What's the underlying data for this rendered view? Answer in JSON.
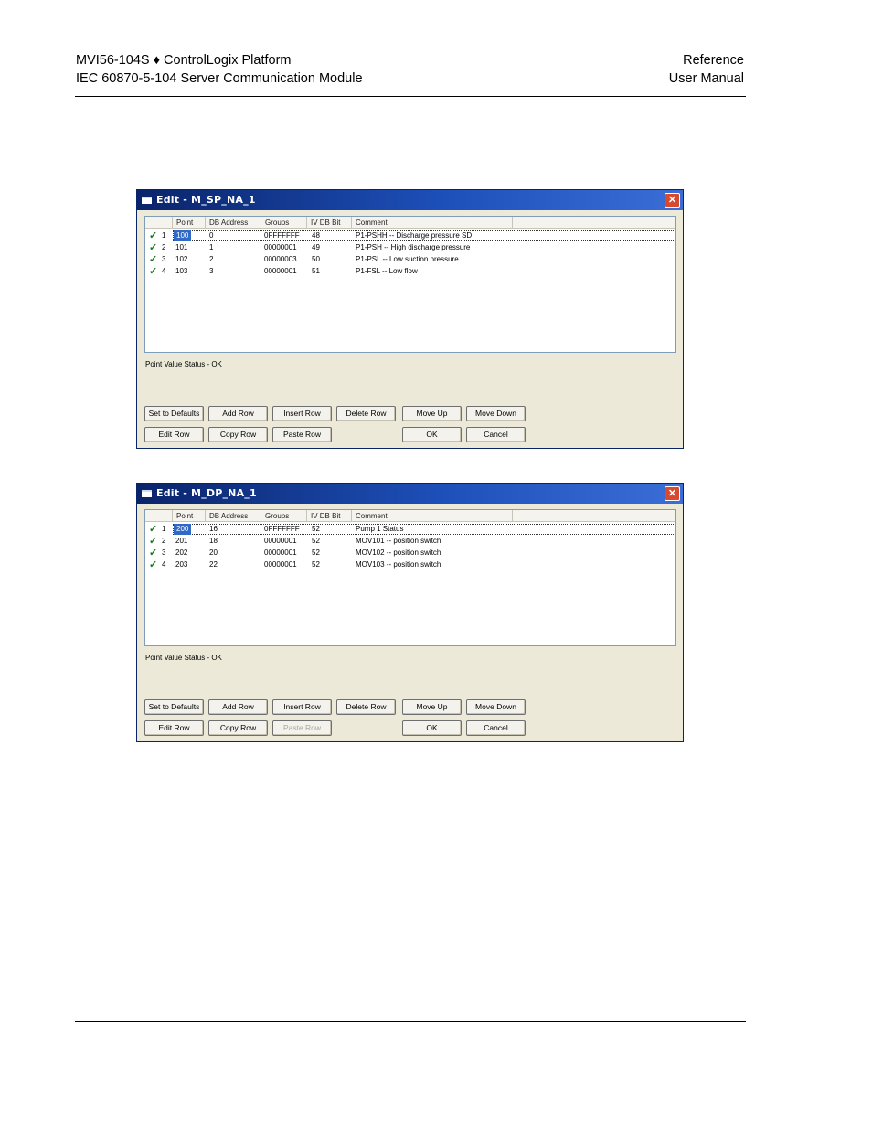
{
  "header": {
    "left_line1": "MVI56-104S ♦ ControlLogix Platform",
    "left_line2": "IEC 60870-5-104 Server Communication Module",
    "right_line1": "Reference",
    "right_line2": "User Manual"
  },
  "dialogs": [
    {
      "title": "Edit - M_SP_NA_1",
      "columns": [
        "Point",
        "DB Address",
        "Groups",
        "IV DB Bit",
        "Comment"
      ],
      "rows": [
        {
          "num": "1",
          "point": "100",
          "db": "0",
          "groups": "0FFFFFFF",
          "iv": "48",
          "comment": "P1-PSHH  -- Discharge pressure SD"
        },
        {
          "num": "2",
          "point": "101",
          "db": "1",
          "groups": "00000001",
          "iv": "49",
          "comment": "P1-PSH  -- High discharge pressure"
        },
        {
          "num": "3",
          "point": "102",
          "db": "2",
          "groups": "00000003",
          "iv": "50",
          "comment": "P1-PSL  -- Low suction pressure"
        },
        {
          "num": "4",
          "point": "103",
          "db": "3",
          "groups": "00000001",
          "iv": "51",
          "comment": "P1-FSL  -- Low flow"
        }
      ],
      "status": "Point Value Status - OK",
      "buttons": {
        "set_defaults": "Set to Defaults",
        "add_row": "Add Row",
        "insert_row": "Insert Row",
        "delete_row": "Delete Row",
        "move_up": "Move Up",
        "move_down": "Move Down",
        "edit_row": "Edit Row",
        "copy_row": "Copy Row",
        "paste_row": "Paste Row",
        "ok": "OK",
        "cancel": "Cancel"
      },
      "paste_enabled": true
    },
    {
      "title": "Edit - M_DP_NA_1",
      "columns": [
        "Point",
        "DB Address",
        "Groups",
        "IV DB Bit",
        "Comment"
      ],
      "rows": [
        {
          "num": "1",
          "point": "200",
          "db": "16",
          "groups": "0FFFFFFF",
          "iv": "52",
          "comment": "Pump 1 Status"
        },
        {
          "num": "2",
          "point": "201",
          "db": "18",
          "groups": "00000001",
          "iv": "52",
          "comment": "MOV101 -- position switch"
        },
        {
          "num": "3",
          "point": "202",
          "db": "20",
          "groups": "00000001",
          "iv": "52",
          "comment": "MOV102 -- position switch"
        },
        {
          "num": "4",
          "point": "203",
          "db": "22",
          "groups": "00000001",
          "iv": "52",
          "comment": "MOV103 -- position switch"
        }
      ],
      "status": "Point Value Status - OK",
      "buttons": {
        "set_defaults": "Set to Defaults",
        "add_row": "Add Row",
        "insert_row": "Insert Row",
        "delete_row": "Delete Row",
        "move_up": "Move Up",
        "move_down": "Move Down",
        "edit_row": "Edit Row",
        "copy_row": "Copy Row",
        "paste_row": "Paste Row",
        "ok": "OK",
        "cancel": "Cancel"
      },
      "paste_enabled": false
    }
  ],
  "colors": {
    "titlebar": "#0a246a",
    "dialog_bg": "#ece9d8",
    "selection": "#3169c6",
    "check": "#1c7a1c"
  }
}
